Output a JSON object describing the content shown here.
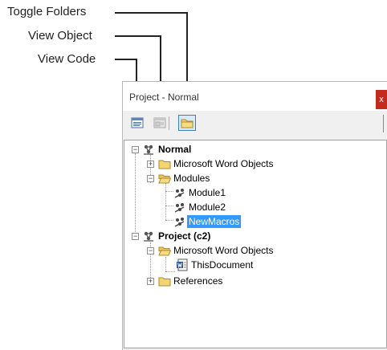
{
  "callouts": {
    "toggle_folders": "Toggle Folders",
    "view_object": "View Object",
    "view_code": "View Code"
  },
  "window": {
    "title": "Project - Normal",
    "close_glyph": "x"
  },
  "toolbar": {
    "buttons": [
      {
        "icon": "view-code-icon"
      },
      {
        "icon": "view-object-icon"
      },
      {
        "icon": "toggle-folders-icon",
        "state": "pressed"
      }
    ]
  },
  "tree": {
    "normal": "Normal",
    "word_objects_1": "Microsoft Word Objects",
    "modules": "Modules",
    "module1": "Module1",
    "module2": "Module2",
    "newmacros": "NewMacros",
    "project": "Project (c2)",
    "word_objects_2": "Microsoft Word Objects",
    "this_document": "ThisDocument",
    "references": "References",
    "selected": "NewMacros"
  },
  "colors": {
    "selection": "#3399ff",
    "close_button": "#c42b1c",
    "folder": "#f2d472"
  }
}
